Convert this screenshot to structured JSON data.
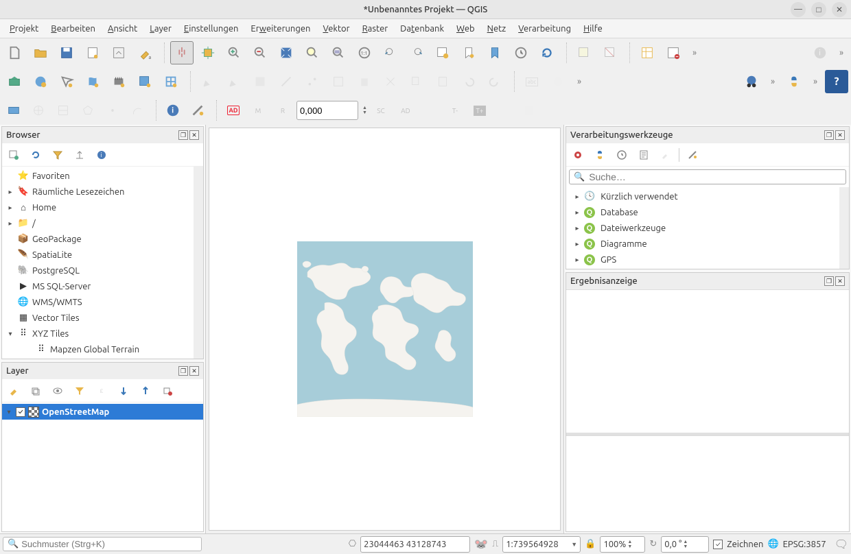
{
  "window": {
    "title": "*Unbenanntes Projekt — QGIS"
  },
  "menus": [
    "Projekt",
    "Bearbeiten",
    "Ansicht",
    "Layer",
    "Einstellungen",
    "Erweiterungen",
    "Vektor",
    "Raster",
    "Datenbank",
    "Web",
    "Netz",
    "Verarbeitung",
    "Hilfe"
  ],
  "menu_accel": [
    "P",
    "B",
    "A",
    "L",
    "E",
    "W",
    "V",
    "R",
    "D",
    "W",
    "N",
    "V",
    "H"
  ],
  "toolbar3": {
    "coord_input": "0,000",
    "ad_label": "AD"
  },
  "browser": {
    "title": "Browser",
    "items": [
      {
        "exp": "",
        "icon": "star",
        "label": "Favoriten"
      },
      {
        "exp": "▸",
        "icon": "bookmark",
        "label": "Räumliche Lesezeichen"
      },
      {
        "exp": "▸",
        "icon": "home",
        "label": "Home"
      },
      {
        "exp": "▸",
        "icon": "folder",
        "label": "/"
      },
      {
        "exp": "",
        "icon": "geopackage",
        "label": "GeoPackage"
      },
      {
        "exp": "",
        "icon": "spatialite",
        "label": "SpatiaLite"
      },
      {
        "exp": "",
        "icon": "postgres",
        "label": "PostgreSQL"
      },
      {
        "exp": "",
        "icon": "mssql",
        "label": "MS SQL-Server"
      },
      {
        "exp": "",
        "icon": "wms",
        "label": "WMS/WMTS"
      },
      {
        "exp": "",
        "icon": "vectortiles",
        "label": "Vector Tiles"
      },
      {
        "exp": "▾",
        "icon": "xyz",
        "label": "XYZ Tiles"
      },
      {
        "exp": "",
        "icon": "xyz-child",
        "label": "Mapzen Global Terrain",
        "indent": true
      }
    ]
  },
  "layers": {
    "title": "Layer",
    "items": [
      {
        "label": "OpenStreetMap",
        "checked": true
      }
    ]
  },
  "processing": {
    "title": "Verarbeitungswerkzeuge",
    "search_placeholder": "Suche…",
    "items": [
      {
        "icon": "clock",
        "label": "Kürzlich verwendet"
      },
      {
        "icon": "q",
        "label": "Database"
      },
      {
        "icon": "q",
        "label": "Dateiwerkzeuge"
      },
      {
        "icon": "q",
        "label": "Diagramme"
      },
      {
        "icon": "q",
        "label": "GPS"
      }
    ]
  },
  "results": {
    "title": "Ergebnisanzeige"
  },
  "status": {
    "search_placeholder": "Suchmuster (Strg+K)",
    "coords": "23044463 43128743",
    "scale": "1:739564928",
    "zoom": "100%",
    "rotation": "0,0 °",
    "render_label": "Zeichnen",
    "crs": "EPSG:3857"
  }
}
